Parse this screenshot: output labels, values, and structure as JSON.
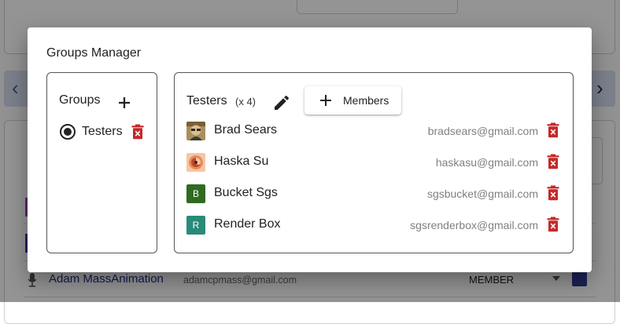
{
  "background": {
    "row": {
      "name": "Adam MassAnimation",
      "email": "adamcpmass@gmail.com",
      "role": "MEMBER"
    }
  },
  "dialog": {
    "title": "Groups Manager",
    "groups": {
      "title": "Groups",
      "items": [
        {
          "name": "Testers",
          "selected": true
        }
      ]
    },
    "members": {
      "group_name": "Testers",
      "count_label": "(x 4)",
      "add_button_label": "Members",
      "items": [
        {
          "name": "Brad Sears",
          "email": "bradsears@gmail.com",
          "avatar": "photo-avatar"
        },
        {
          "name": "Haska Su",
          "email": "haskasu@gmail.com",
          "avatar": "swirl-avatar"
        },
        {
          "name": "Bucket Sgs",
          "email": "sgsbucket@gmail.com",
          "avatar_letter": "B",
          "avatar_color": "#2e6b21"
        },
        {
          "name": "Render Box",
          "email": "sgsrenderbox@gmail.com",
          "avatar_letter": "R",
          "avatar_color": "#2a8a7a"
        }
      ]
    }
  },
  "colors": {
    "delete_red": "#c62828",
    "nav_bar": "#d6dcef",
    "link_blue": "#1f2d8a"
  }
}
